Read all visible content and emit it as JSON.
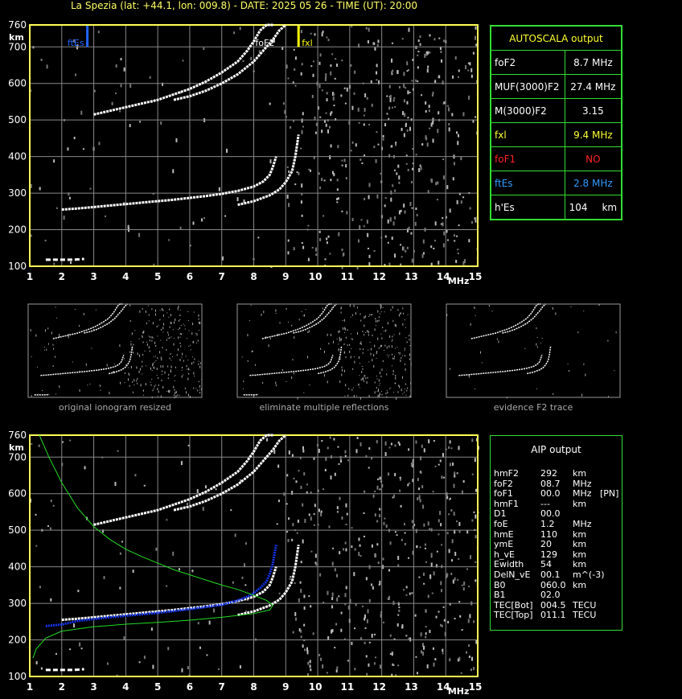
{
  "header": "La Spezia (lat: +44.1, lon: 009.8) - DATE: 2025 05 26 - TIME (UT): 20:00",
  "colors": {
    "axis": "#ffff55",
    "grid": "#888888",
    "trace": "#ffffff",
    "ftes": "#2266ff",
    "fxl": "#ffff00",
    "profile": "#22dd22",
    "aip_trace": "#1133ee",
    "box": "#33dd33"
  },
  "autoscala": {
    "title": "AUTOSCALA output",
    "rows": [
      {
        "label": "foF2",
        "value": "8.7 MHz",
        "color": "#ffffff"
      },
      {
        "label": "MUF(3000)F2",
        "value": "27.4 MHz",
        "color": "#ffffff"
      },
      {
        "label": "M(3000)F2",
        "value": "3.15",
        "color": "#ffffff"
      },
      {
        "label": "fxl",
        "value": "9.4 MHz",
        "color": "#ffff33"
      },
      {
        "label": "foF1",
        "value": "NO",
        "color": "#ff2222"
      },
      {
        "label": "ftEs",
        "value": "2.8 MHz",
        "color": "#3399ff"
      },
      {
        "label": "h'Es",
        "value": "104",
        "unit": "km",
        "color": "#ffffff"
      }
    ]
  },
  "aip": {
    "title": "AIP output",
    "rows": [
      {
        "name": "hmF2",
        "value": "292",
        "unit": "km",
        "extra": ""
      },
      {
        "name": "foF2",
        "value": "08.7",
        "unit": "MHz",
        "extra": ""
      },
      {
        "name": "foF1",
        "value": "00.0",
        "unit": "MHz",
        "extra": "[PN]"
      },
      {
        "name": "hmF1",
        "value": "---",
        "unit": "km",
        "extra": ""
      },
      {
        "name": "D1",
        "value": "00.0",
        "unit": "",
        "extra": ""
      },
      {
        "name": "foE",
        "value": "1.2",
        "unit": "MHz",
        "extra": ""
      },
      {
        "name": "hmE",
        "value": "110",
        "unit": "km",
        "extra": ""
      },
      {
        "name": "ymE",
        "value": "20",
        "unit": "km",
        "extra": ""
      },
      {
        "name": "h_vE",
        "value": "129",
        "unit": "km",
        "extra": ""
      },
      {
        "name": "Ewidth",
        "value": "54",
        "unit": "km",
        "extra": ""
      },
      {
        "name": "DelN_vE",
        "value": "00.1",
        "unit": "m^(-3)",
        "extra": ""
      },
      {
        "name": "B0",
        "value": "060.0",
        "unit": "km",
        "extra": ""
      },
      {
        "name": "B1",
        "value": "02.0",
        "unit": "",
        "extra": ""
      },
      {
        "name": "TEC[Bot]",
        "value": "004.5",
        "unit": "TECU",
        "extra": ""
      },
      {
        "name": "TEC[Top]",
        "value": "011.1",
        "unit": "TECU",
        "extra": ""
      }
    ]
  },
  "thumbnails": [
    {
      "caption": "original ionogram resized"
    },
    {
      "caption": "eliminate multiple reflections"
    },
    {
      "caption": "evidence F2 trace"
    }
  ],
  "chart_data": [
    {
      "type": "scatter",
      "xlabel": "MHz",
      "ylabel": "km",
      "xlim": [
        1,
        15
      ],
      "ylim": [
        100,
        760
      ],
      "xticks": [
        1,
        2,
        3,
        4,
        5,
        6,
        7,
        8,
        9,
        10,
        11,
        12,
        13,
        14,
        15
      ],
      "yticks": [
        100,
        200,
        300,
        400,
        500,
        600,
        700,
        760
      ],
      "annotations": [
        {
          "text": "ftEs",
          "x": 2.8
        },
        {
          "text": "foF2",
          "x": 8.7
        },
        {
          "text": "fxl",
          "x": 9.4
        }
      ],
      "series": [
        {
          "role": "trace_o",
          "x": [
            2.0,
            2.5,
            3.0,
            3.5,
            4.0,
            4.5,
            5.0,
            5.5,
            6.0,
            6.5,
            7.0,
            7.5,
            8.0,
            8.3,
            8.5,
            8.6,
            8.7
          ],
          "y": [
            255,
            258,
            262,
            266,
            270,
            274,
            278,
            282,
            287,
            292,
            298,
            306,
            318,
            332,
            350,
            372,
            400
          ]
        },
        {
          "role": "trace_x",
          "x": [
            7.5,
            8.0,
            8.5,
            8.8,
            9.0,
            9.2,
            9.3,
            9.4
          ],
          "y": [
            268,
            278,
            294,
            310,
            330,
            360,
            400,
            460
          ]
        },
        {
          "role": "multiple",
          "x": [
            3.0,
            3.5,
            4.0,
            4.5,
            5.0,
            5.5,
            6.0,
            6.5,
            7.0,
            7.5,
            7.8,
            8.0,
            8.2,
            8.4,
            8.6
          ],
          "y": [
            515,
            525,
            535,
            545,
            555,
            570,
            585,
            605,
            630,
            660,
            690,
            715,
            745,
            760,
            760
          ]
        },
        {
          "role": "multiple_x",
          "x": [
            5.5,
            6.0,
            6.5,
            7.0,
            7.5,
            8.0,
            8.3,
            8.6,
            8.8,
            9.0
          ],
          "y": [
            555,
            565,
            580,
            600,
            625,
            660,
            690,
            720,
            745,
            760
          ]
        },
        {
          "role": "es",
          "x": [
            1.5,
            1.8,
            2.1,
            2.4,
            2.7
          ],
          "y": [
            118,
            118,
            118,
            118,
            120
          ]
        }
      ]
    },
    {
      "type": "scatter",
      "xlabel": "MHz",
      "ylabel": "km",
      "xlim": [
        1,
        15
      ],
      "ylim": [
        100,
        760
      ],
      "xticks": [
        1,
        2,
        3,
        4,
        5,
        6,
        7,
        8,
        9,
        10,
        11,
        12,
        13,
        14,
        15
      ],
      "yticks": [
        100,
        200,
        300,
        400,
        500,
        600,
        700,
        760
      ],
      "series": [
        {
          "role": "trace_o",
          "x": [
            2.0,
            2.5,
            3.0,
            3.5,
            4.0,
            4.5,
            5.0,
            5.5,
            6.0,
            6.5,
            7.0,
            7.5,
            8.0,
            8.3,
            8.5,
            8.6,
            8.7
          ],
          "y": [
            255,
            258,
            262,
            266,
            270,
            274,
            278,
            282,
            287,
            292,
            298,
            306,
            318,
            332,
            350,
            372,
            400
          ]
        },
        {
          "role": "trace_x",
          "x": [
            7.5,
            8.0,
            8.5,
            8.8,
            9.0,
            9.2,
            9.3,
            9.4
          ],
          "y": [
            268,
            278,
            294,
            310,
            330,
            360,
            400,
            460
          ]
        },
        {
          "role": "multiple",
          "x": [
            3.0,
            3.5,
            4.0,
            4.5,
            5.0,
            5.5,
            6.0,
            6.5,
            7.0,
            7.5,
            7.8,
            8.0,
            8.2,
            8.4,
            8.6
          ],
          "y": [
            515,
            525,
            535,
            545,
            555,
            570,
            585,
            605,
            630,
            660,
            690,
            715,
            745,
            760,
            760
          ]
        },
        {
          "role": "multiple_x",
          "x": [
            5.5,
            6.0,
            6.5,
            7.0,
            7.5,
            8.0,
            8.3,
            8.6,
            8.8,
            9.0
          ],
          "y": [
            555,
            565,
            580,
            600,
            625,
            660,
            690,
            720,
            745,
            760
          ]
        },
        {
          "role": "es",
          "x": [
            1.5,
            1.8,
            2.1,
            2.4,
            2.7
          ],
          "y": [
            118,
            118,
            118,
            118,
            120
          ]
        },
        {
          "role": "aip_fit",
          "x": [
            1.5,
            2.0,
            2.5,
            3.0,
            3.5,
            4.0,
            4.5,
            5.0,
            5.5,
            6.0,
            6.5,
            7.0,
            7.5,
            7.8,
            8.0,
            8.2,
            8.4,
            8.5,
            8.6,
            8.7
          ],
          "y": [
            238,
            242,
            252,
            257,
            262,
            266,
            270,
            274,
            279,
            284,
            290,
            296,
            308,
            318,
            328,
            342,
            360,
            380,
            410,
            460
          ]
        },
        {
          "role": "profile",
          "x": [
            1.3,
            1.6,
            2.0,
            2.5,
            3.0,
            3.5,
            4.0,
            4.5,
            5.0,
            5.5,
            6.0,
            6.5,
            7.0,
            7.5,
            8.0,
            8.4,
            8.6,
            8.5,
            8.0,
            7.0,
            6.0,
            5.0,
            4.0,
            3.0,
            2.0,
            1.5,
            1.2,
            1.1
          ],
          "y": [
            760,
            700,
            630,
            560,
            510,
            475,
            448,
            428,
            410,
            392,
            378,
            364,
            350,
            338,
            322,
            308,
            295,
            282,
            272,
            262,
            254,
            248,
            243,
            236,
            224,
            205,
            175,
            150
          ]
        }
      ]
    }
  ]
}
